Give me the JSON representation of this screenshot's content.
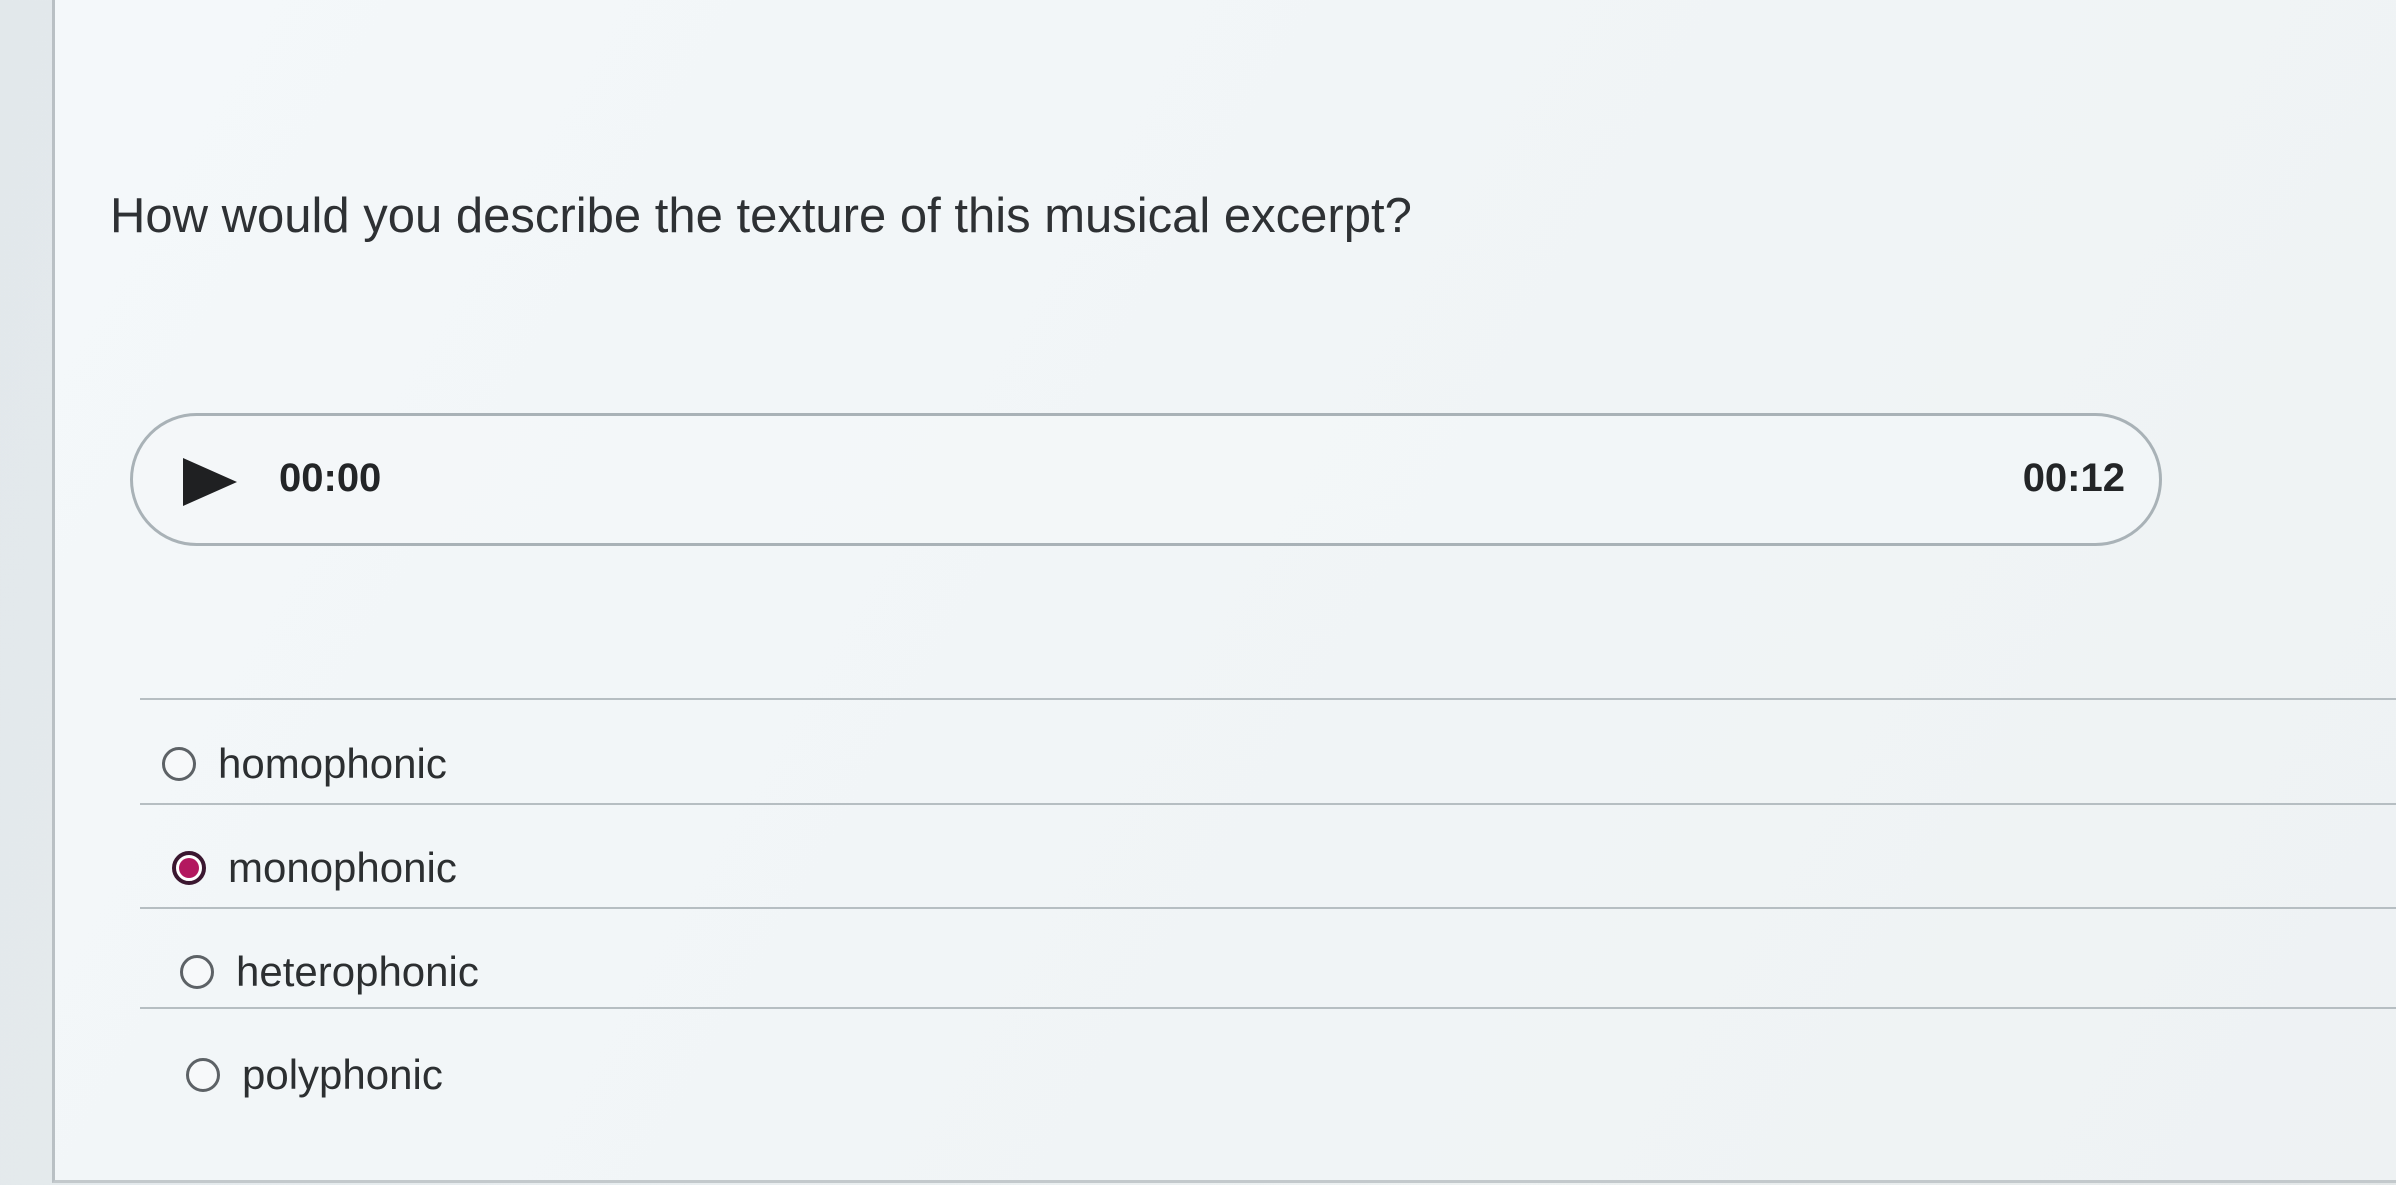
{
  "question": {
    "text": "How would you describe the texture of this musical excerpt?"
  },
  "audio_player": {
    "play_icon": "play-icon",
    "current_time": "00:00",
    "duration": "00:12"
  },
  "options": [
    {
      "label": "homophonic",
      "selected": false
    },
    {
      "label": "monophonic",
      "selected": true
    },
    {
      "label": "heterophonic",
      "selected": false
    },
    {
      "label": "polyphonic",
      "selected": false
    }
  ],
  "colors": {
    "selected_radio": "#b3185f"
  }
}
